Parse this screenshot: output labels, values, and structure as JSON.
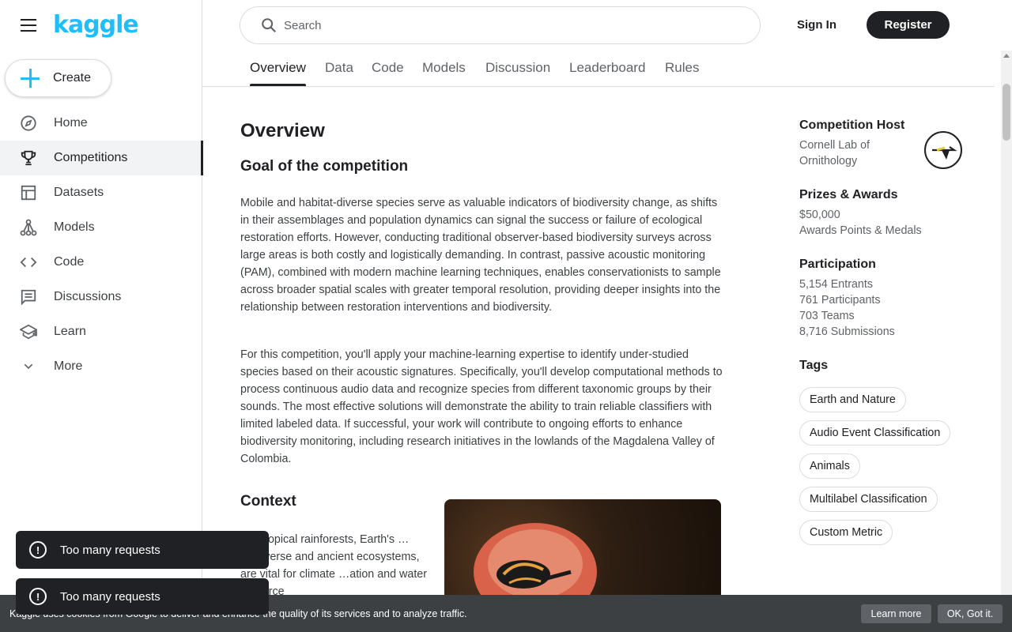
{
  "brand": {
    "logo_text": "kaggle"
  },
  "sidebar": {
    "create_label": "Create",
    "items": [
      {
        "label": "Home",
        "icon": "compass-icon"
      },
      {
        "label": "Competitions",
        "icon": "trophy-icon",
        "active": true
      },
      {
        "label": "Datasets",
        "icon": "table-icon"
      },
      {
        "label": "Models",
        "icon": "models-icon"
      },
      {
        "label": "Code",
        "icon": "code-icon"
      },
      {
        "label": "Discussions",
        "icon": "discussion-icon"
      },
      {
        "label": "Learn",
        "icon": "school-icon"
      },
      {
        "label": "More",
        "icon": "chevron-down-icon"
      }
    ]
  },
  "header": {
    "search_placeholder": "Search",
    "signin_label": "Sign In",
    "register_label": "Register"
  },
  "tabs": [
    "Overview",
    "Data",
    "Code",
    "Models",
    "Discussion",
    "Leaderboard",
    "Rules"
  ],
  "main": {
    "title": "Overview",
    "goal_heading": "Goal of the competition",
    "paragraph1": "Mobile and habitat-diverse species serve as valuable indicators of biodiversity change, as shifts in their assemblages and population dynamics can signal the success or failure of ecological restoration efforts. However, conducting traditional observer-based biodiversity surveys across large areas is both costly and logistically demanding. In contrast, passive acoustic monitoring (PAM), combined with modern machine learning techniques, enables conservationists to sample across broader spatial scales with greater temporal resolution, providing deeper insights into the relationship between restoration interventions and biodiversity.",
    "paragraph2": "For this competition, you'll apply your machine-learning expertise to identify under-studied species based on their acoustic signatures. Specifically, you'll develop computational methods to process continuous audio data and recognize species from different taxonomic groups by their sounds. The most effective solutions will demonstrate the ability to train reliable classifiers with limited labeled data. If successful, your work will contribute to ongoing efforts to enhance biodiversity monitoring, including research initiatives in the lowlands of the Magdalena Valley of Colombia.",
    "context_heading": "Context",
    "context_text": "…d tropical rainforests, Earth's …biodiverse and ancient ecosystems, are vital for climate …ation and water resource"
  },
  "side": {
    "host_heading": "Competition Host",
    "host_name": "Cornell Lab of Ornithology",
    "prizes_heading": "Prizes & Awards",
    "prize_amount": "$50,000",
    "prize_extra": "Awards Points & Medals",
    "participation_heading": "Participation",
    "entrants": "5,154 Entrants",
    "participants": "761 Participants",
    "teams": "703 Teams",
    "submissions": "8,716 Submissions",
    "tags_heading": "Tags",
    "tags": [
      "Earth and Nature",
      "Audio Event Classification",
      "Animals",
      "Multilabel Classification",
      "Custom Metric"
    ]
  },
  "toasts": [
    "Too many requests",
    "Too many requests"
  ],
  "cookie": {
    "text": "Kaggle uses cookies from Google to deliver and enhance the quality of its services and to analyze traffic.",
    "learn_more": "Learn more",
    "ok": "OK, Got it."
  },
  "colors": {
    "brand": "#20beff",
    "dark": "#202124",
    "toast_bg": "#202124",
    "cookie_bg": "#3c4043"
  }
}
